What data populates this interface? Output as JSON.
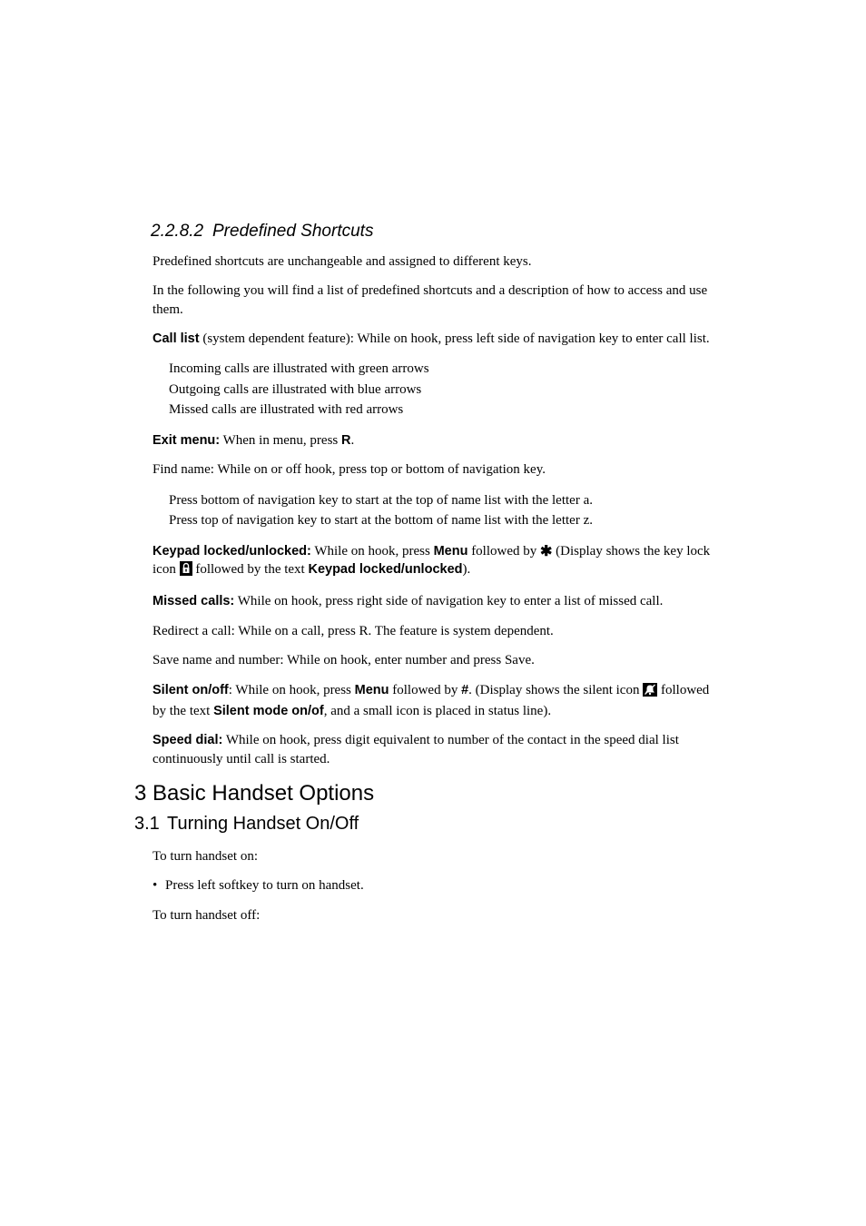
{
  "section_minor": {
    "number": "2.2.8.2",
    "title": "Predefined Shortcuts"
  },
  "p1": "Predefined shortcuts are unchangeable and assigned to different keys.",
  "p2": "In the following you will find a list of predefined shortcuts and a description of how to access and use them.",
  "call_list": {
    "label": "Call list",
    "text": " (system dependent feature): While on hook, press left side of navigation key to enter call list.",
    "items": [
      "Incoming calls are illustrated with green arrows",
      "Outgoing calls are illustrated with blue arrows",
      "Missed calls are illustrated with red arrows"
    ]
  },
  "exit_menu": {
    "label": "Exit menu:",
    "text_a": " When in menu, press ",
    "key": "R",
    "text_b": "."
  },
  "find_name": {
    "text": "Find name: While on or off hook, press top or bottom of navigation key.",
    "items": [
      "Press bottom of navigation key to start at the top of name list with the letter a.",
      "Press top of navigation key to start at the bottom of name list with the letter z."
    ]
  },
  "keypad": {
    "label": "Keypad locked/unlocked:",
    "text_a": " While on hook, press ",
    "key_menu": "Menu",
    "text_b": " followed by ",
    "star": "✱",
    "text_c": " (Display shows the key lock icon ",
    "text_d": " followed by the text ",
    "text_label2": "Keypad locked/unlocked",
    "text_e": ")."
  },
  "missed": {
    "label": "Missed calls:",
    "text": " While on hook, press right side of navigation key to enter a list of missed call."
  },
  "redirect": "Redirect a call: While on a call, press R. The feature is system dependent.",
  "save_name": "Save name and number: While on hook, enter number and press Save.",
  "silent": {
    "label": "Silent on/off",
    "text_a": ": While on hook, press ",
    "key_menu": "Menu",
    "text_b": " followed by ",
    "hash": "#",
    "text_c": ". (Display shows the silent icon ",
    "text_d": " followed by the text ",
    "text_label2": "Silent mode on/of",
    "text_e": ", and a small icon is placed in status line)."
  },
  "speed": {
    "label": "Speed dial:",
    "text": " While on hook, press digit equivalent to number of the contact in the speed dial list continuously until call is started."
  },
  "h1": {
    "num": "3",
    "title": "Basic Handset Options"
  },
  "h2": {
    "num": "3.1",
    "title": "Turning Handset On/Off"
  },
  "turn_on": "To turn handset on:",
  "turn_on_bullet": "Press left softkey to turn on handset.",
  "turn_off": "To turn handset off:"
}
